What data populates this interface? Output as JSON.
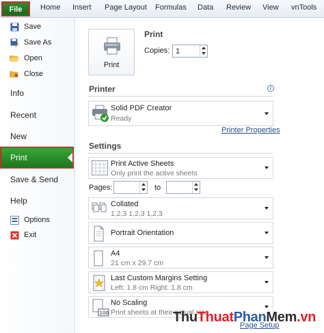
{
  "ribbon": {
    "file": "File",
    "tabs": [
      "Home",
      "Insert",
      "Page Layout",
      "Formulas",
      "Data",
      "Review",
      "View",
      "vnTools"
    ]
  },
  "nav": {
    "save": "Save",
    "save_as": "Save As",
    "open": "Open",
    "close": "Close",
    "info": "Info",
    "recent": "Recent",
    "new": "New",
    "print": "Print",
    "save_send": "Save & Send",
    "help": "Help",
    "options": "Options",
    "exit": "Exit"
  },
  "print": {
    "title": "Print",
    "button": "Print",
    "copies_label": "Copies:",
    "copies_value": "1"
  },
  "printer": {
    "title": "Printer",
    "name": "Solid PDF Creator",
    "status": "Ready",
    "properties_link": "Printer Properties"
  },
  "settings": {
    "title": "Settings",
    "what": {
      "main": "Print Active Sheets",
      "sub": "Only print the active sheets"
    },
    "pages_label": "Pages:",
    "to_label": "to",
    "collate": {
      "main": "Collated",
      "sub": "1,2,3    1,2,3    1,2,3"
    },
    "orientation": {
      "main": "Portrait Orientation"
    },
    "paper": {
      "main": "A4",
      "sub": "21 cm x 29.7 cm"
    },
    "margins": {
      "main": "Last Custom Margins Setting",
      "sub": "Left: 1.8 cm    Right: 1.8 cm"
    },
    "scaling": {
      "main": "No Scaling",
      "sub": "Print sheets at their actual size"
    },
    "page_setup_link": "Page Setup"
  },
  "watermark": {
    "a": "Thu",
    "b": "Thuat",
    "c": "Phan",
    "d": "Mem",
    "e": ".vn"
  },
  "colors": {
    "file_green": "#1a6b1a",
    "highlight_red": "#c0332b",
    "link_blue": "#2b4f86"
  }
}
